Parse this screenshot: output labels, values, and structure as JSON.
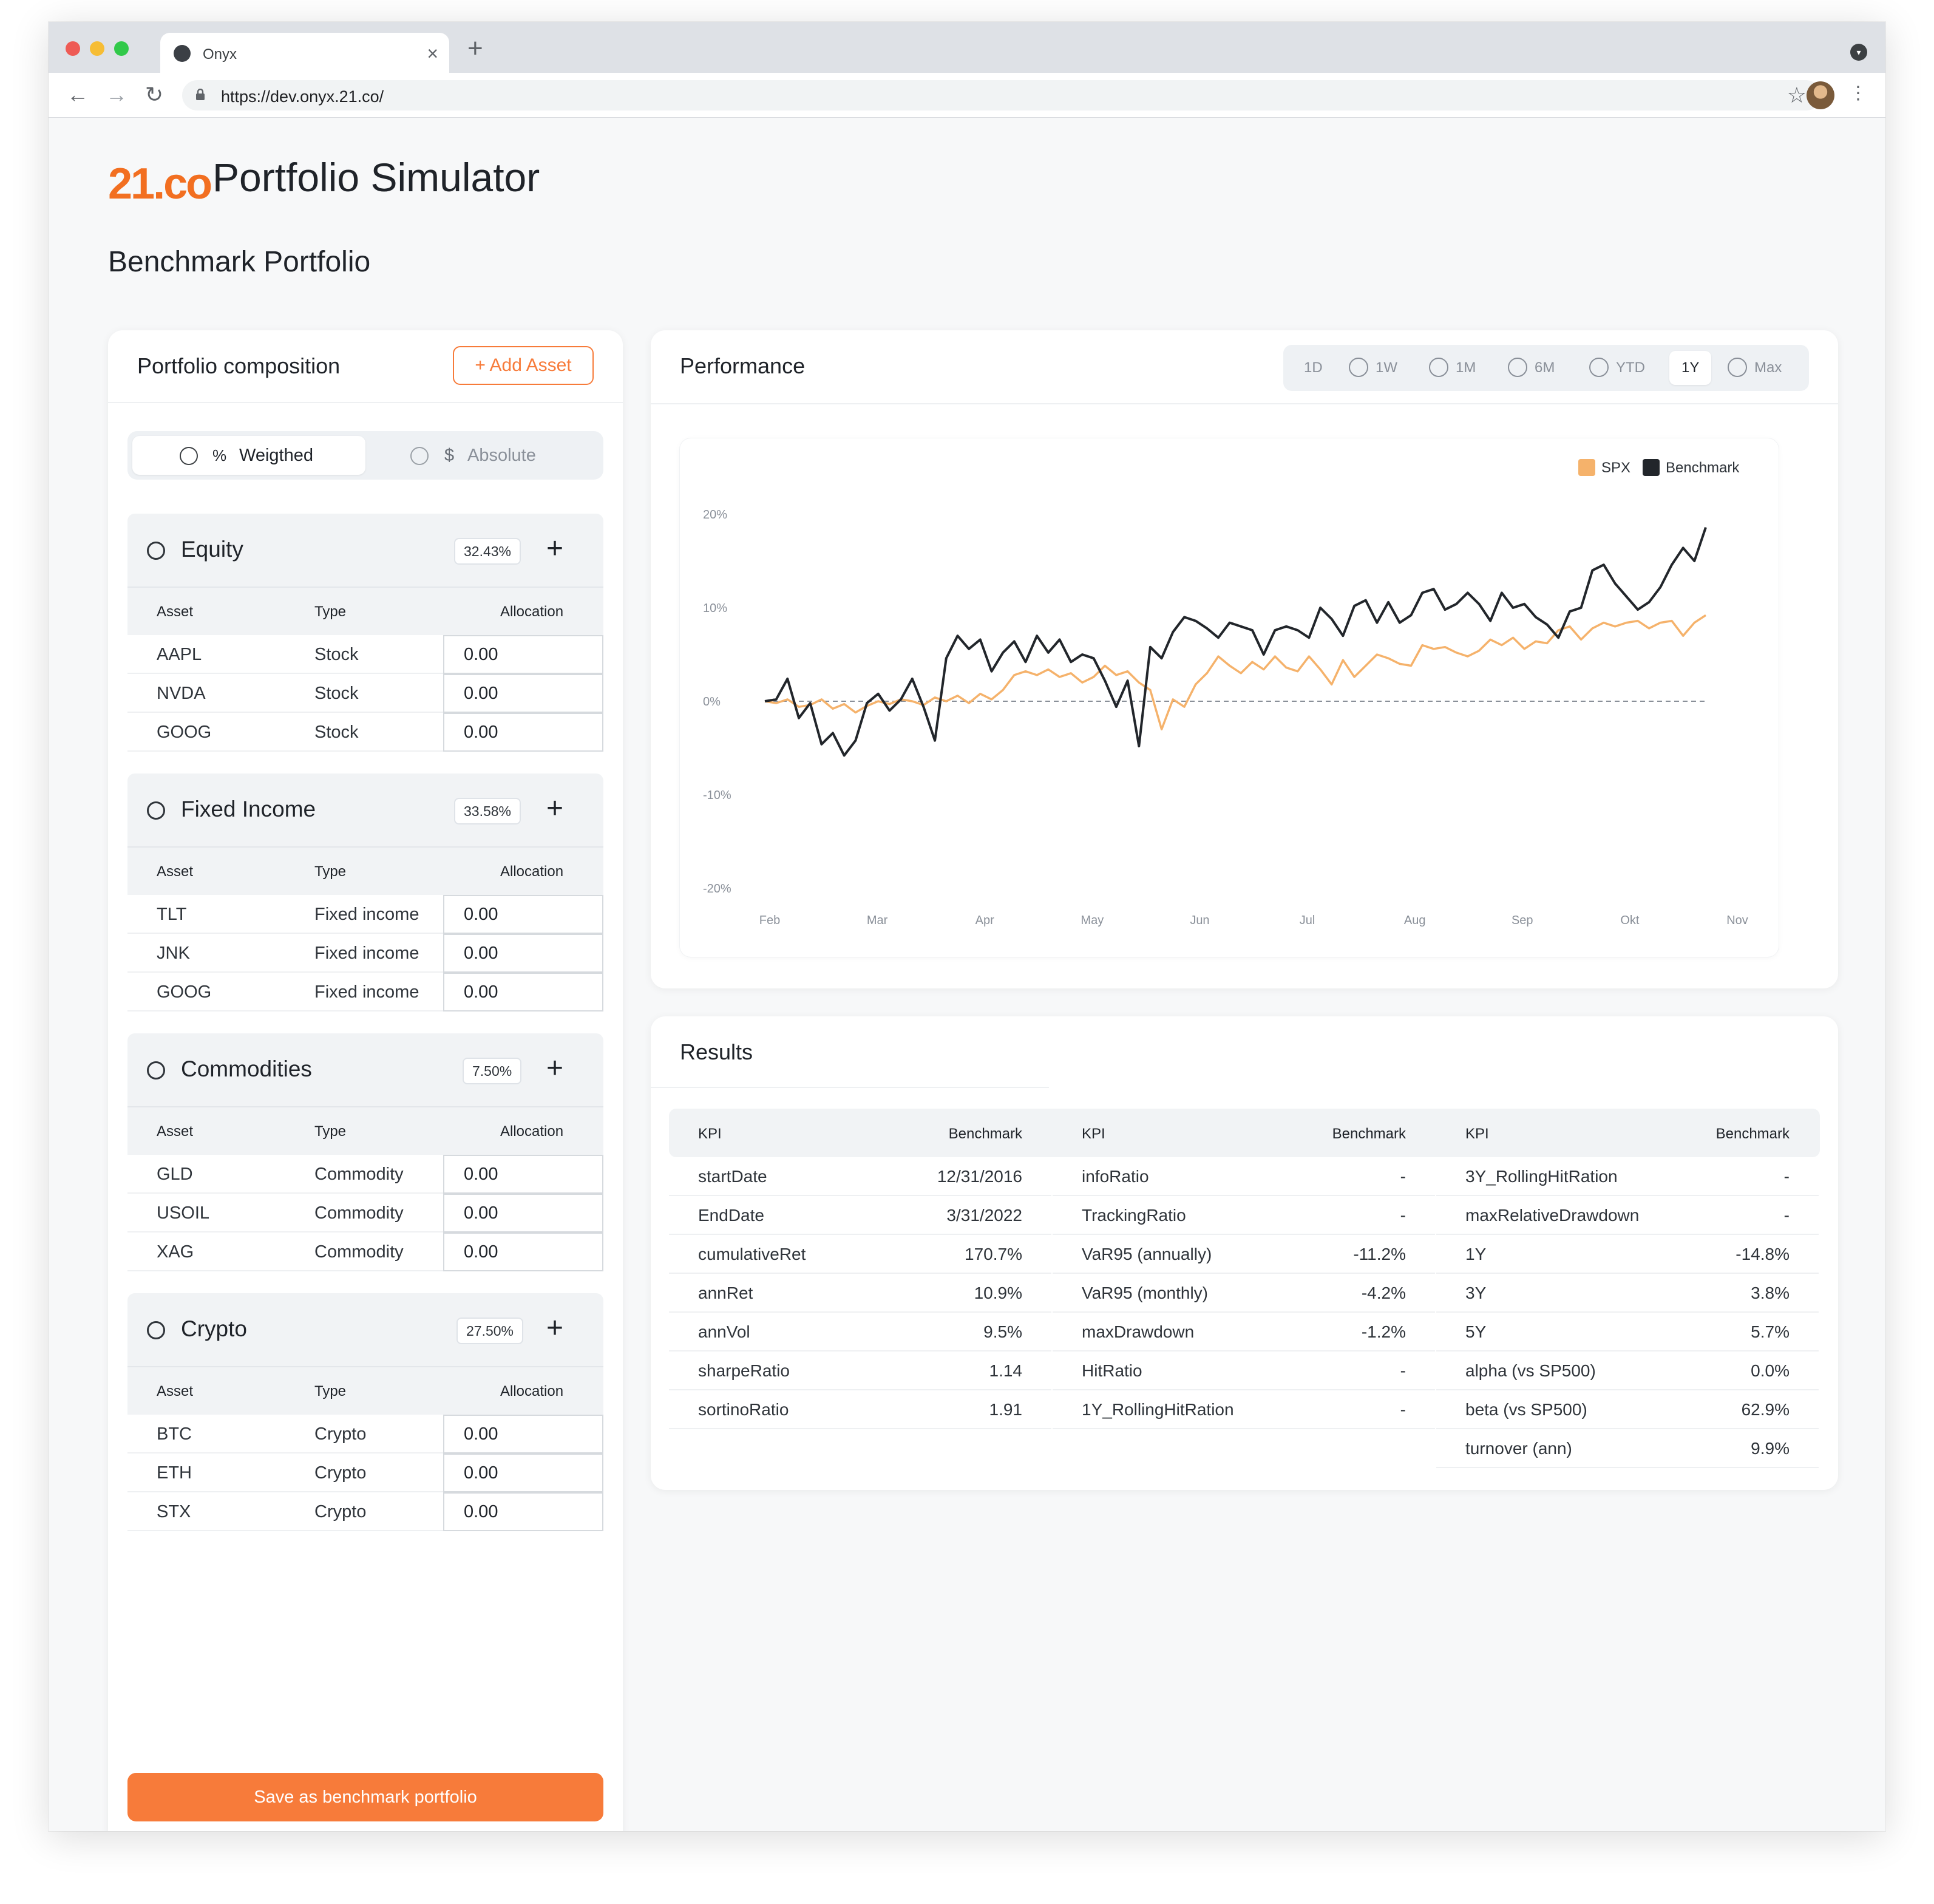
{
  "browser": {
    "tab_title": "Onyx",
    "tab_close": "×",
    "new_tab": "+",
    "url": "https://dev.onyx.21.co/",
    "nav": {
      "back": "←",
      "forward": "→",
      "reload": "↻"
    },
    "star": "☆",
    "menu": "⋮",
    "chrome_menu": "▾",
    "traffic_lights": [
      "#ee5b55",
      "#f6bd35",
      "#31c94a"
    ]
  },
  "header": {
    "logo": "21.co",
    "title": "Portfolio Simulator",
    "section": "Benchmark Portfolio"
  },
  "composition": {
    "title": "Portfolio composition",
    "add_asset_label": "+  Add Asset",
    "mode_weighted": "Weigthed",
    "mode_weighted_icon": "%",
    "mode_absolute": "Absolute",
    "mode_absolute_icon": "$",
    "col_asset": "Asset",
    "col_type": "Type",
    "col_allocation": "Allocation",
    "plus": "+",
    "groups": [
      {
        "name": "Equity",
        "icon": "pie-chart-icon",
        "weight": "32.43%",
        "rows": [
          {
            "asset": "AAPL",
            "type": "Stock",
            "alloc": "0.00"
          },
          {
            "asset": "NVDA",
            "type": "Stock",
            "alloc": "0.00"
          },
          {
            "asset": "GOOG",
            "type": "Stock",
            "alloc": "0.00"
          }
        ]
      },
      {
        "name": "Fixed Income",
        "icon": "coin-icon",
        "weight": "33.58%",
        "rows": [
          {
            "asset": "TLT",
            "type": "Fixed income",
            "alloc": "0.00"
          },
          {
            "asset": "JNK",
            "type": "Fixed income",
            "alloc": "0.00"
          },
          {
            "asset": "GOOG",
            "type": "Fixed income",
            "alloc": "0.00"
          }
        ]
      },
      {
        "name": "Commodities",
        "icon": "globe-icon",
        "weight": "7.50%",
        "rows": [
          {
            "asset": "GLD",
            "type": "Commodity",
            "alloc": "0.00"
          },
          {
            "asset": "USOIL",
            "type": "Commodity",
            "alloc": "0.00"
          },
          {
            "asset": "XAG",
            "type": "Commodity",
            "alloc": "0.00"
          }
        ]
      },
      {
        "name": "Crypto",
        "icon": "crypto-coin-icon",
        "weight": "27.50%",
        "rows": [
          {
            "asset": "BTC",
            "type": "Crypto",
            "alloc": "0.00"
          },
          {
            "asset": "ETH",
            "type": "Crypto",
            "alloc": "0.00"
          },
          {
            "asset": "STX",
            "type": "Crypto",
            "alloc": "0.00"
          }
        ]
      }
    ],
    "save_label": "Save as benchmark portfolio"
  },
  "performance": {
    "title": "Performance",
    "periods": [
      "1D",
      "1W",
      "1M",
      "6M",
      "YTD",
      "1Y",
      "Max"
    ],
    "active_period": "1Y"
  },
  "chart_data": {
    "type": "line",
    "x_labels": [
      "Feb",
      "Mar",
      "Apr",
      "May",
      "Jun",
      "Jul",
      "Aug",
      "Sep",
      "Okt",
      "Nov"
    ],
    "y_ticks": [
      "20%",
      "10%",
      "0%",
      "-10%",
      "-20%"
    ],
    "ylim": [
      -20,
      20
    ],
    "grid": false,
    "legend_position": "top-right",
    "baseline": 0,
    "series": [
      {
        "name": "SPX",
        "color": "#f5b26b",
        "values": [
          0,
          -0.2,
          0.2,
          -0.6,
          -0.4,
          0.2,
          -0.8,
          -0.3,
          -1.2,
          -0.5,
          0.0,
          -0.3,
          0.2,
          0.0,
          -0.4,
          0.4,
          0.0,
          0.6,
          -0.2,
          0.8,
          0.2,
          1.2,
          2.8,
          3.2,
          2.8,
          3.4,
          2.6,
          3.0,
          2.0,
          2.6,
          3.8,
          2.8,
          3.2,
          2.0,
          1.2,
          -3.0,
          0.2,
          -0.6,
          1.8,
          3.0,
          4.8,
          3.8,
          3.0,
          4.2,
          3.4,
          4.8,
          3.6,
          3.2,
          4.8,
          3.4,
          1.8,
          4.4,
          2.6,
          3.8,
          5.0,
          4.6,
          4.0,
          3.8,
          6.0,
          5.6,
          5.8,
          5.2,
          4.8,
          5.4,
          6.6,
          6.0,
          6.8,
          5.6,
          6.4,
          6.2,
          7.6,
          8.0,
          6.6,
          7.8,
          8.4,
          8.0,
          8.4,
          8.6,
          7.8,
          8.4,
          8.6,
          7.0,
          8.4,
          9.2
        ]
      },
      {
        "name": "Benchmark",
        "color": "#22262b",
        "values": [
          0,
          0.2,
          2.4,
          -1.8,
          -0.2,
          -4.6,
          -3.4,
          -5.8,
          -4.2,
          -0.2,
          0.8,
          -1.0,
          0.2,
          2.4,
          -0.6,
          -4.2,
          4.6,
          7.0,
          5.6,
          6.6,
          3.2,
          5.2,
          6.4,
          4.2,
          7.0,
          5.2,
          6.6,
          4.2,
          5.0,
          4.6,
          2.2,
          -0.6,
          2.2,
          -4.8,
          5.8,
          4.6,
          7.4,
          9.0,
          8.6,
          7.8,
          6.8,
          8.4,
          8.0,
          7.6,
          5.0,
          7.6,
          8.0,
          7.6,
          6.8,
          10.0,
          8.8,
          7.0,
          10.2,
          10.8,
          8.4,
          10.6,
          8.4,
          9.2,
          11.6,
          12.0,
          9.8,
          10.4,
          11.6,
          10.4,
          8.6,
          11.6,
          10.0,
          10.4,
          9.0,
          8.2,
          6.8,
          9.6,
          10.0,
          14.0,
          14.6,
          12.6,
          11.2,
          9.8,
          10.6,
          12.2,
          14.6,
          16.4,
          15.0,
          18.6
        ]
      }
    ]
  },
  "results": {
    "title": "Results",
    "head_kpi": "KPI",
    "head_benchmark": "Benchmark",
    "columns": [
      [
        {
          "k": "startDate",
          "v": "12/31/2016"
        },
        {
          "k": "EndDate",
          "v": "3/31/2022"
        },
        {
          "k": "cumulativeRet",
          "v": "170.7%"
        },
        {
          "k": "annRet",
          "v": "10.9%"
        },
        {
          "k": "annVol",
          "v": "9.5%"
        },
        {
          "k": "sharpeRatio",
          "v": "1.14"
        },
        {
          "k": "sortinoRatio",
          "v": "1.91"
        }
      ],
      [
        {
          "k": "infoRatio",
          "v": "-"
        },
        {
          "k": "TrackingRatio",
          "v": "-"
        },
        {
          "k": "VaR95 (annually)",
          "v": "-11.2%"
        },
        {
          "k": "VaR95 (monthly)",
          "v": "-4.2%"
        },
        {
          "k": "maxDrawdown",
          "v": "-1.2%"
        },
        {
          "k": "HitRatio",
          "v": "-"
        },
        {
          "k": "1Y_RollingHitRation",
          "v": "-"
        }
      ],
      [
        {
          "k": "3Y_RollingHitRation",
          "v": "-"
        },
        {
          "k": "maxRelativeDrawdown",
          "v": "-"
        },
        {
          "k": "1Y",
          "v": "-14.8%"
        },
        {
          "k": "3Y",
          "v": "3.8%"
        },
        {
          "k": "5Y",
          "v": "5.7%"
        },
        {
          "k": "alpha (vs SP500)",
          "v": "0.0%"
        },
        {
          "k": "beta (vs SP500)",
          "v": "62.9%"
        },
        {
          "k": "turnover (ann)",
          "v": "9.9%"
        }
      ]
    ]
  }
}
